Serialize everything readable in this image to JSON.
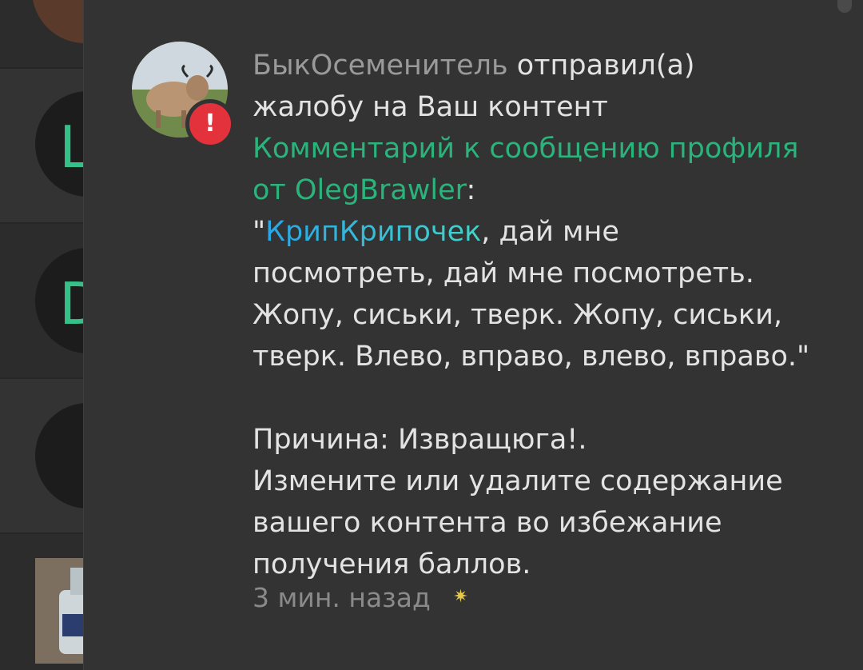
{
  "background": {
    "avatars": [
      {
        "letter": ""
      },
      {
        "letter": "L"
      },
      {
        "letter": "D"
      },
      {
        "letter": ""
      },
      {
        "letter": ""
      }
    ]
  },
  "notification": {
    "author": "БыкОсеменитель",
    "action_line1": " отправил(а)",
    "action_line2": "жалобу на Ваш контент",
    "link_line1": "Комментарий к сообщению профиля",
    "link_line2": "от OlegBrawler",
    "colon": ":",
    "quote_open": "\"",
    "mention": "КрипКрипочек",
    "quote_line1_rest": ", дай мне",
    "quote_line2": "посмотреть, дай мне посмотреть.",
    "quote_line3": "Жопу, сиськи, тверк. Жопу, сиськи,",
    "quote_line4": "тверк. Влево, вправо, влево, вправо.\"",
    "reason_line": "Причина: Извращюга!.",
    "advice_line1": "Измените или удалите содержание",
    "advice_line2": "вашего контента во избежание",
    "advice_line3": "получения баллов.",
    "time": "3 мин. назад",
    "badge": "!"
  },
  "colors": {
    "panel_bg": "#333333",
    "link": "#2bb37c",
    "author": "#9a9a9a",
    "alert": "#e3323b"
  },
  "icons": [
    "alert-icon",
    "star-icon"
  ]
}
